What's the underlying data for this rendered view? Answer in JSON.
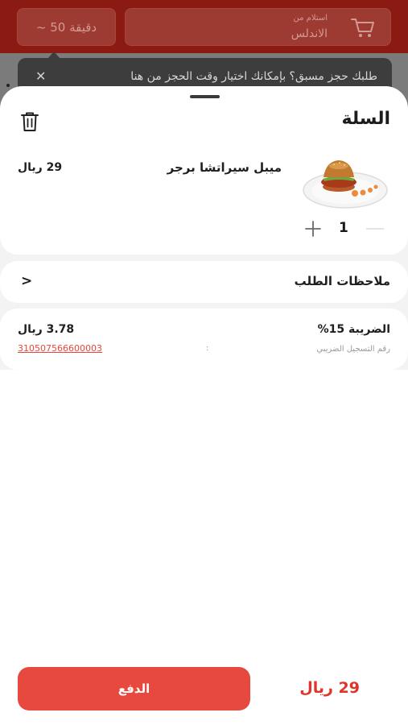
{
  "background": {
    "time_estimate": "~ 50 دقيقة",
    "pickup_caption": "استلام من",
    "pickup_branch": "الاندلس",
    "tooltip_text": "طلبك حجز مسبق؟ بإمكانك اختيار وقت الحجز من هنا",
    "tooltip_close": "✕"
  },
  "cart": {
    "title": "السلة",
    "items": [
      {
        "name": "ميبل سيراتشا برجر",
        "price": "29 ريال",
        "quantity": "1"
      }
    ],
    "notes_label": "ملاحظات الطلب",
    "tax_label": "الضريبة 15%",
    "tax_value": "3.78 ريال",
    "vat_label": "رقم التسجيل الضريبي",
    "vat_colon": ":",
    "vat_number": "310507566600003"
  },
  "footer": {
    "pay_label": "الدفع",
    "total": "29 ريال"
  },
  "colors": {
    "accent": "#e8493e",
    "total_text": "#e0352b",
    "vat_link": "#e8463b",
    "header_bg": "#8a1a12"
  },
  "icons": [
    "cart-icon",
    "trash-icon",
    "close-icon",
    "chevron-left-icon",
    "plus-icon",
    "minus-icon"
  ]
}
